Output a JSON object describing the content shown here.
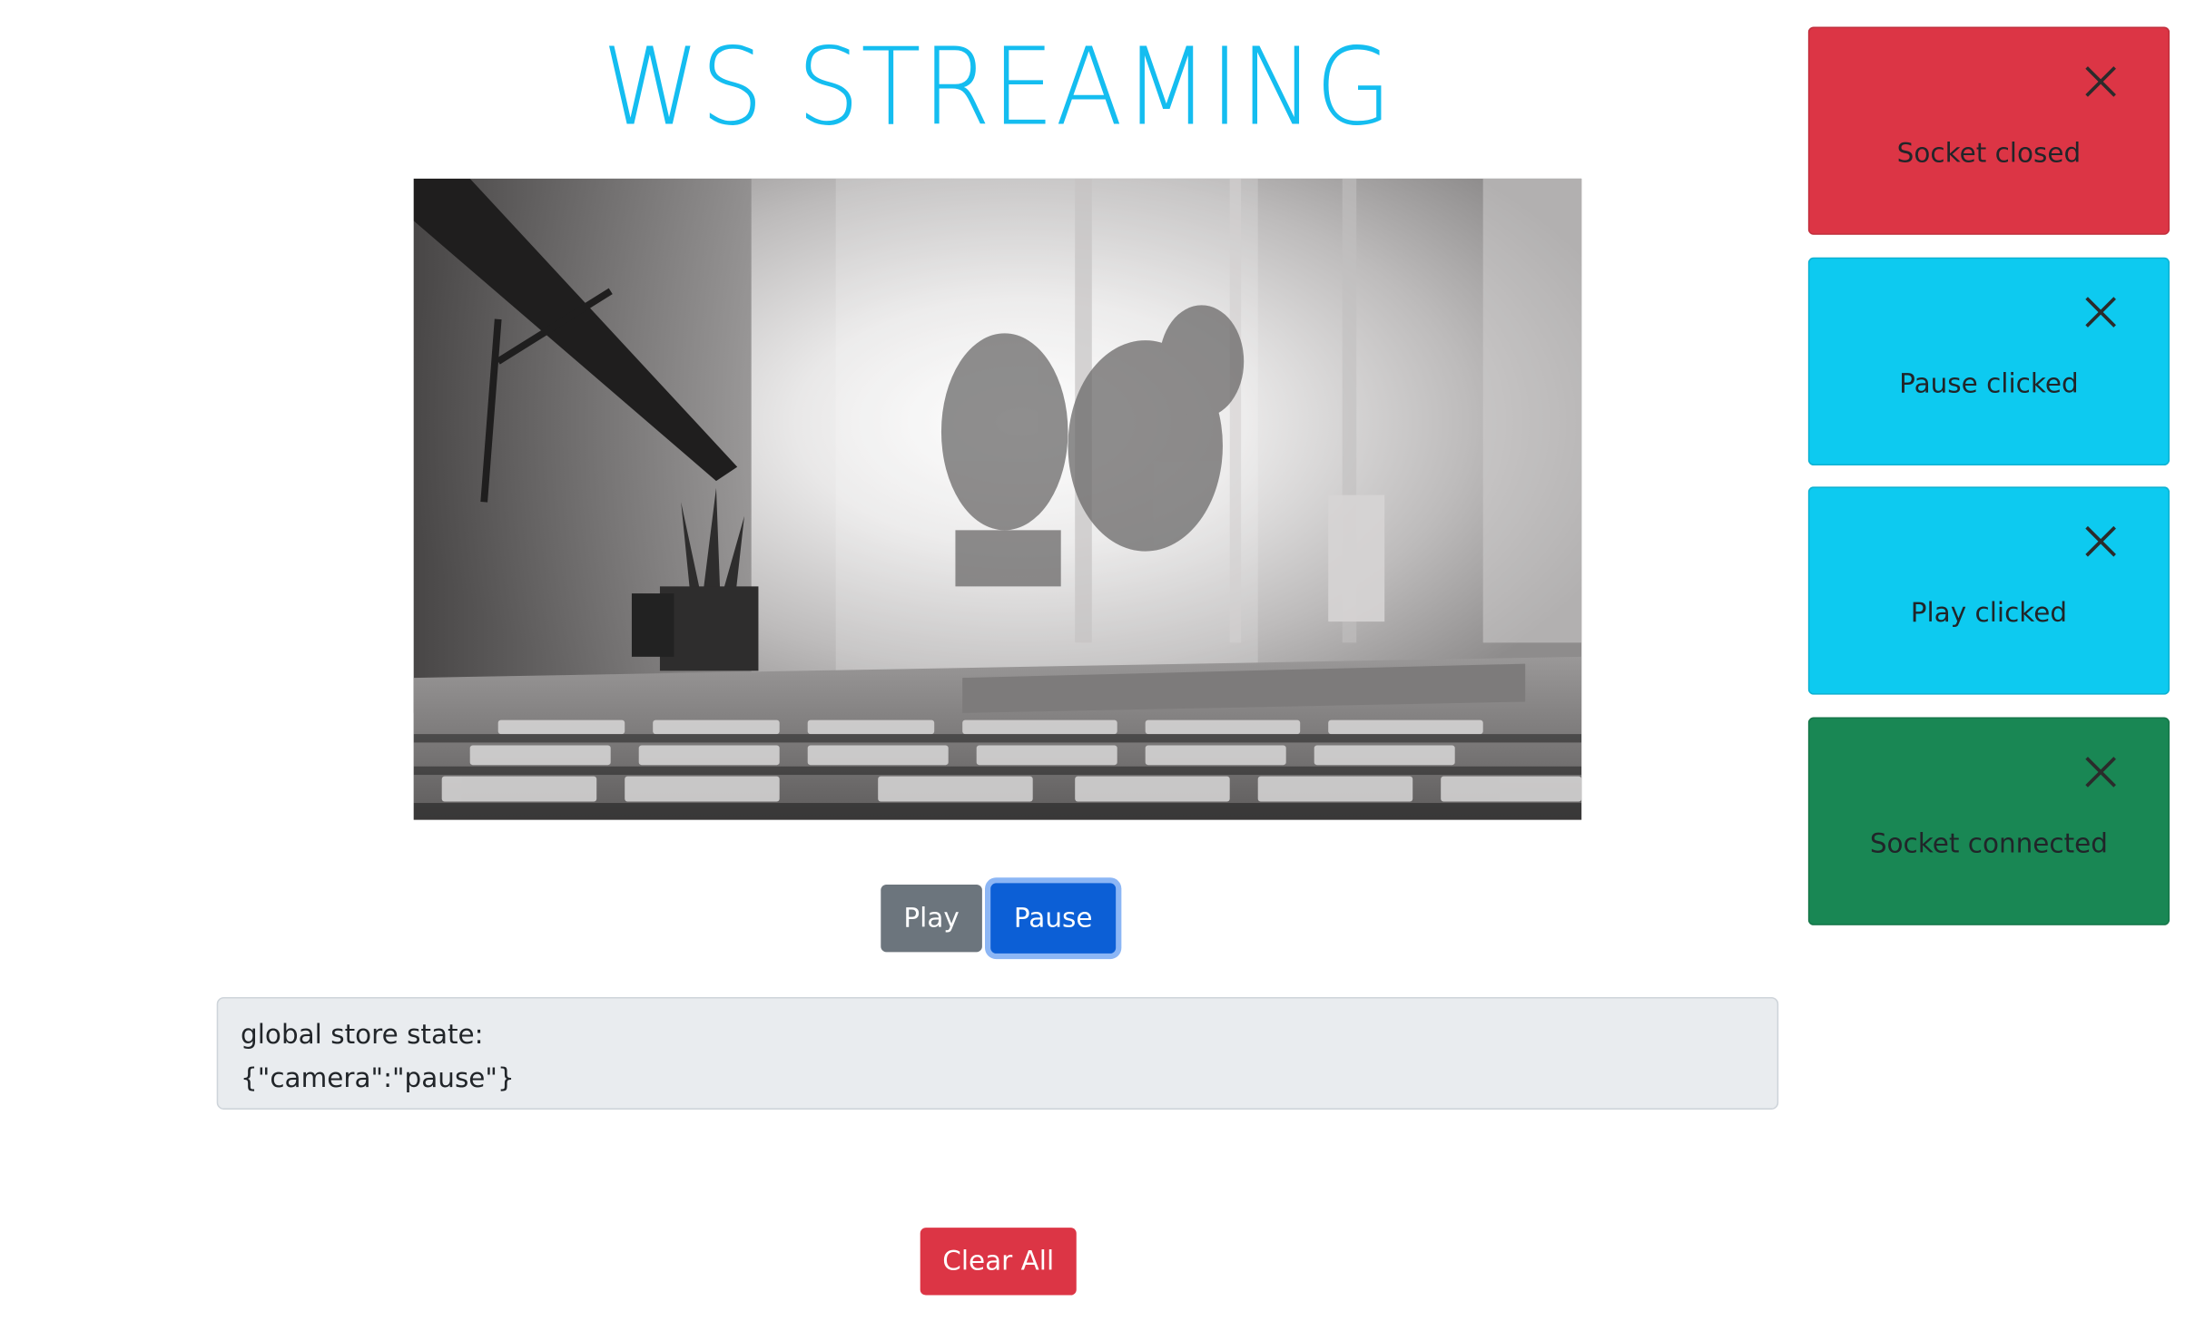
{
  "header": {
    "title": "WS STREAMING"
  },
  "controls": {
    "play_label": "Play",
    "pause_label": "Pause",
    "clear_label": "Clear All"
  },
  "state": {
    "label": "global store state:",
    "value": "{\"camera\":\"pause\"}"
  },
  "toasts": [
    {
      "message": "Socket closed",
      "variant": "danger",
      "color": "#dc3545",
      "icon": "close-icon"
    },
    {
      "message": "Pause clicked",
      "variant": "info",
      "color": "#0dcaf0",
      "icon": "close-icon"
    },
    {
      "message": "Play clicked",
      "variant": "info",
      "color": "#0dcaf0",
      "icon": "close-icon"
    },
    {
      "message": "Socket connected",
      "variant": "success",
      "color": "#198754",
      "icon": "close-icon"
    }
  ],
  "colors": {
    "title": "#14bdf0",
    "play_button": "#6c757d",
    "pause_button": "#0c5fd6",
    "clear_button": "#dc3545",
    "state_box": "#e9ecef"
  }
}
